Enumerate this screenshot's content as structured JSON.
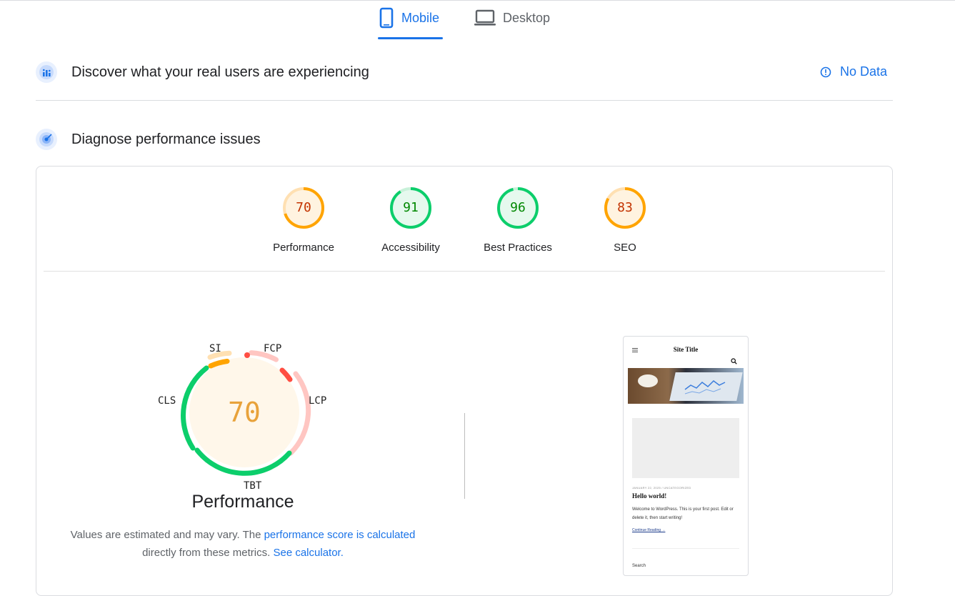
{
  "tabs": {
    "mobile_label": "Mobile",
    "desktop_label": "Desktop",
    "active": "Mobile"
  },
  "field_data": {
    "title": "Discover what your real users are experiencing",
    "status_label": "No Data"
  },
  "diagnose": {
    "title": "Diagnose performance issues"
  },
  "scores": [
    {
      "label": "Performance",
      "value": "70",
      "status": "average"
    },
    {
      "label": "Accessibility",
      "value": "91",
      "status": "pass"
    },
    {
      "label": "Best Practices",
      "value": "96",
      "status": "pass"
    },
    {
      "label": "SEO",
      "value": "83",
      "status": "average"
    }
  ],
  "performance_gauge": {
    "score": "70",
    "title": "Performance",
    "metrics": {
      "si": "SI",
      "fcp": "FCP",
      "lcp": "LCP",
      "tbt": "TBT",
      "cls": "CLS"
    }
  },
  "note": {
    "text1": "Values are estimated and may vary. The ",
    "link1": "performance score is calculated",
    "text2": "directly from these metrics.",
    "link2": "See calculator."
  },
  "screenshot": {
    "site_title": "Site Title",
    "post_meta": "JANUARY 22, 2025  /  UNCATEGORIZED",
    "post_title": "Hello world!",
    "post_text": "Welcome to WordPress. This is your first post. Edit or delete it, then start writing!",
    "continue_label": "Continue Reading →",
    "search_label": "Search"
  },
  "colors": {
    "accent": "#1a73e8",
    "pass": "#0cce6b",
    "average": "#ffa400",
    "fail": "#ff4e42"
  }
}
